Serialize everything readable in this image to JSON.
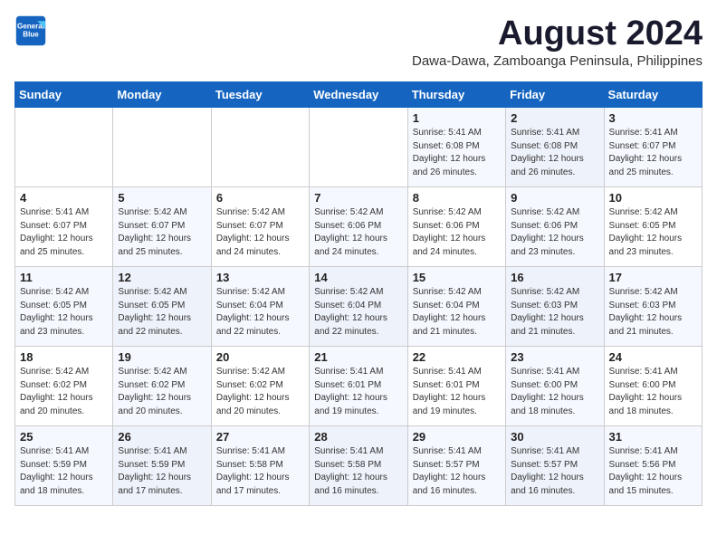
{
  "header": {
    "logo_line1": "General",
    "logo_line2": "Blue",
    "month": "August 2024",
    "location": "Dawa-Dawa, Zamboanga Peninsula, Philippines"
  },
  "weekdays": [
    "Sunday",
    "Monday",
    "Tuesday",
    "Wednesday",
    "Thursday",
    "Friday",
    "Saturday"
  ],
  "weeks": [
    [
      {
        "day": "",
        "info": ""
      },
      {
        "day": "",
        "info": ""
      },
      {
        "day": "",
        "info": ""
      },
      {
        "day": "",
        "info": ""
      },
      {
        "day": "1",
        "info": "Sunrise: 5:41 AM\nSunset: 6:08 PM\nDaylight: 12 hours\nand 26 minutes."
      },
      {
        "day": "2",
        "info": "Sunrise: 5:41 AM\nSunset: 6:08 PM\nDaylight: 12 hours\nand 26 minutes."
      },
      {
        "day": "3",
        "info": "Sunrise: 5:41 AM\nSunset: 6:07 PM\nDaylight: 12 hours\nand 25 minutes."
      }
    ],
    [
      {
        "day": "4",
        "info": "Sunrise: 5:41 AM\nSunset: 6:07 PM\nDaylight: 12 hours\nand 25 minutes."
      },
      {
        "day": "5",
        "info": "Sunrise: 5:42 AM\nSunset: 6:07 PM\nDaylight: 12 hours\nand 25 minutes."
      },
      {
        "day": "6",
        "info": "Sunrise: 5:42 AM\nSunset: 6:07 PM\nDaylight: 12 hours\nand 24 minutes."
      },
      {
        "day": "7",
        "info": "Sunrise: 5:42 AM\nSunset: 6:06 PM\nDaylight: 12 hours\nand 24 minutes."
      },
      {
        "day": "8",
        "info": "Sunrise: 5:42 AM\nSunset: 6:06 PM\nDaylight: 12 hours\nand 24 minutes."
      },
      {
        "day": "9",
        "info": "Sunrise: 5:42 AM\nSunset: 6:06 PM\nDaylight: 12 hours\nand 23 minutes."
      },
      {
        "day": "10",
        "info": "Sunrise: 5:42 AM\nSunset: 6:05 PM\nDaylight: 12 hours\nand 23 minutes."
      }
    ],
    [
      {
        "day": "11",
        "info": "Sunrise: 5:42 AM\nSunset: 6:05 PM\nDaylight: 12 hours\nand 23 minutes."
      },
      {
        "day": "12",
        "info": "Sunrise: 5:42 AM\nSunset: 6:05 PM\nDaylight: 12 hours\nand 22 minutes."
      },
      {
        "day": "13",
        "info": "Sunrise: 5:42 AM\nSunset: 6:04 PM\nDaylight: 12 hours\nand 22 minutes."
      },
      {
        "day": "14",
        "info": "Sunrise: 5:42 AM\nSunset: 6:04 PM\nDaylight: 12 hours\nand 22 minutes."
      },
      {
        "day": "15",
        "info": "Sunrise: 5:42 AM\nSunset: 6:04 PM\nDaylight: 12 hours\nand 21 minutes."
      },
      {
        "day": "16",
        "info": "Sunrise: 5:42 AM\nSunset: 6:03 PM\nDaylight: 12 hours\nand 21 minutes."
      },
      {
        "day": "17",
        "info": "Sunrise: 5:42 AM\nSunset: 6:03 PM\nDaylight: 12 hours\nand 21 minutes."
      }
    ],
    [
      {
        "day": "18",
        "info": "Sunrise: 5:42 AM\nSunset: 6:02 PM\nDaylight: 12 hours\nand 20 minutes."
      },
      {
        "day": "19",
        "info": "Sunrise: 5:42 AM\nSunset: 6:02 PM\nDaylight: 12 hours\nand 20 minutes."
      },
      {
        "day": "20",
        "info": "Sunrise: 5:42 AM\nSunset: 6:02 PM\nDaylight: 12 hours\nand 20 minutes."
      },
      {
        "day": "21",
        "info": "Sunrise: 5:41 AM\nSunset: 6:01 PM\nDaylight: 12 hours\nand 19 minutes."
      },
      {
        "day": "22",
        "info": "Sunrise: 5:41 AM\nSunset: 6:01 PM\nDaylight: 12 hours\nand 19 minutes."
      },
      {
        "day": "23",
        "info": "Sunrise: 5:41 AM\nSunset: 6:00 PM\nDaylight: 12 hours\nand 18 minutes."
      },
      {
        "day": "24",
        "info": "Sunrise: 5:41 AM\nSunset: 6:00 PM\nDaylight: 12 hours\nand 18 minutes."
      }
    ],
    [
      {
        "day": "25",
        "info": "Sunrise: 5:41 AM\nSunset: 5:59 PM\nDaylight: 12 hours\nand 18 minutes."
      },
      {
        "day": "26",
        "info": "Sunrise: 5:41 AM\nSunset: 5:59 PM\nDaylight: 12 hours\nand 17 minutes."
      },
      {
        "day": "27",
        "info": "Sunrise: 5:41 AM\nSunset: 5:58 PM\nDaylight: 12 hours\nand 17 minutes."
      },
      {
        "day": "28",
        "info": "Sunrise: 5:41 AM\nSunset: 5:58 PM\nDaylight: 12 hours\nand 16 minutes."
      },
      {
        "day": "29",
        "info": "Sunrise: 5:41 AM\nSunset: 5:57 PM\nDaylight: 12 hours\nand 16 minutes."
      },
      {
        "day": "30",
        "info": "Sunrise: 5:41 AM\nSunset: 5:57 PM\nDaylight: 12 hours\nand 16 minutes."
      },
      {
        "day": "31",
        "info": "Sunrise: 5:41 AM\nSunset: 5:56 PM\nDaylight: 12 hours\nand 15 minutes."
      }
    ]
  ]
}
